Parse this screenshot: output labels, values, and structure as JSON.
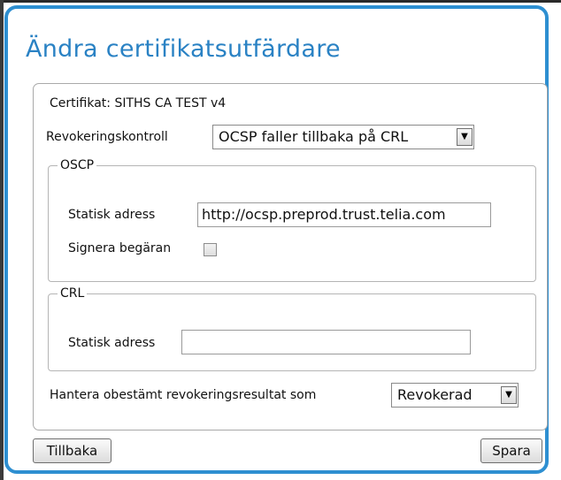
{
  "dialog": {
    "title": "Ändra certifikatsutfärdare"
  },
  "form": {
    "certificate_label": "Certifikat: SITHS CA TEST v4",
    "revocation_label": "Revokeringskontroll",
    "revocation_selected": "OCSP faller tillbaka på CRL",
    "oscp": {
      "legend": "OSCP",
      "static_address_label": "Statisk adress",
      "static_address_value": "http://ocsp.preprod.trust.telia.com",
      "sign_request_label": "Signera begäran",
      "sign_request_checked": false
    },
    "crl": {
      "legend": "CRL",
      "static_address_label": "Statisk adress",
      "static_address_value": ""
    },
    "undetermined_label": "Hantera obestämt revokeringsresultat som",
    "undetermined_selected": "Revokerad"
  },
  "buttons": {
    "back": "Tillbaka",
    "save": "Spara"
  },
  "colors": {
    "dialog_border": "#2e8fd1",
    "title": "#2a82c4"
  }
}
